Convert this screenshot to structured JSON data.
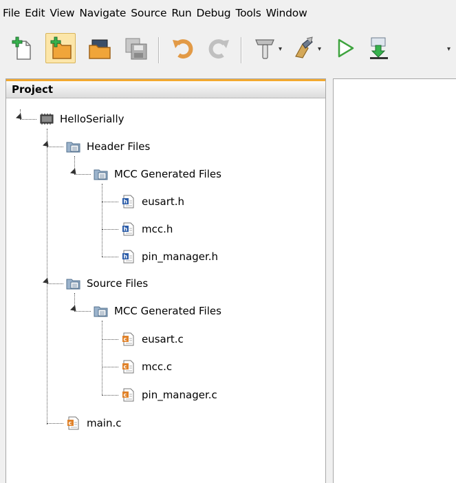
{
  "menu": [
    "File",
    "Edit",
    "View",
    "Navigate",
    "Source",
    "Run",
    "Debug",
    "Tools",
    "Window"
  ],
  "toolbar": {
    "buttons": [
      "new-file-icon",
      "new-project-icon",
      "open-project-icon",
      "save-all-icon",
      "undo-icon",
      "redo-icon",
      "build-icon",
      "clean-build-icon",
      "run-icon",
      "program-device-icon"
    ]
  },
  "project_panel": {
    "title": "Project"
  },
  "tree": {
    "project": "HelloSerially",
    "header_files": "Header Files",
    "header_mcc": "MCC Generated Files",
    "header_children": [
      "eusart.h",
      "mcc.h",
      "pin_manager.h"
    ],
    "source_files": "Source Files",
    "source_mcc": "MCC Generated Files",
    "source_children": [
      "eusart.c",
      "mcc.c",
      "pin_manager.c"
    ],
    "main": "main.c"
  },
  "colors": {
    "tab_accent": "#f3a92f",
    "header_file_icon": "#2b5ca8",
    "source_file_icon": "#e0822a",
    "folder": "#6f93b8"
  }
}
